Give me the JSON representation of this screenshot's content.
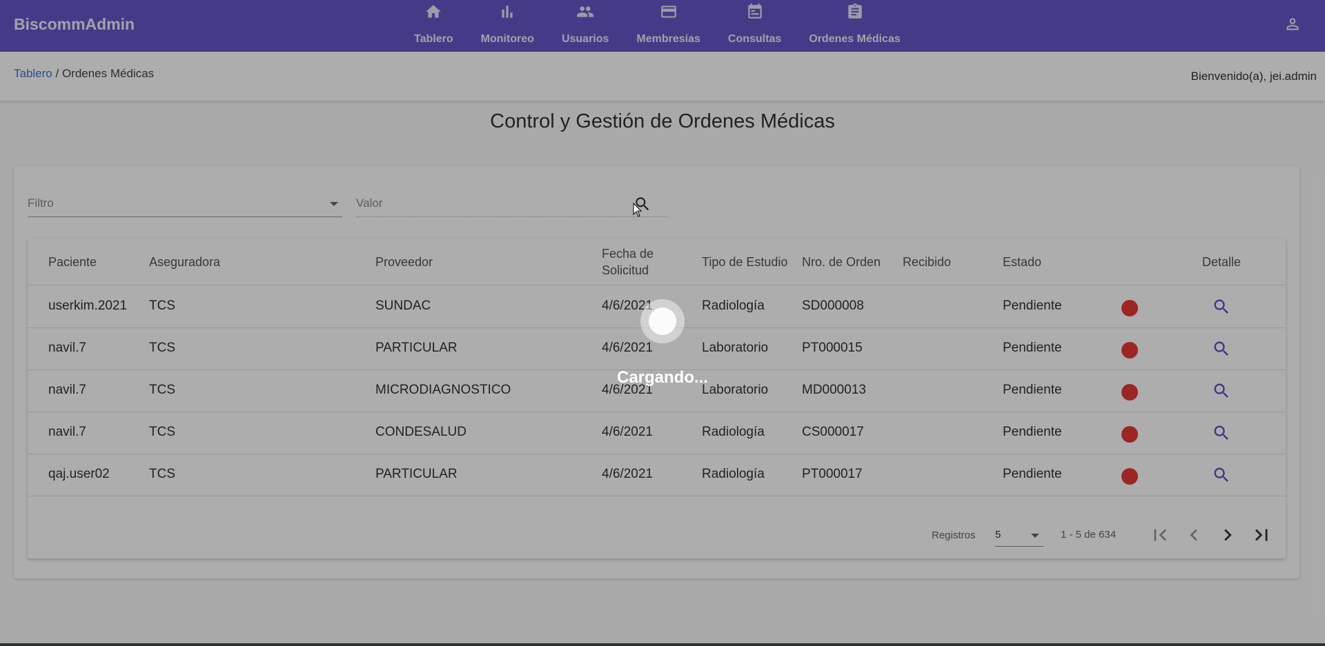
{
  "app": {
    "title": "BiscommAdmin"
  },
  "nav": [
    {
      "label": "Tablero",
      "icon": "home-icon"
    },
    {
      "label": "Monitoreo",
      "icon": "bar-chart-icon"
    },
    {
      "label": "Usuarios",
      "icon": "people-icon"
    },
    {
      "label": "Membresías",
      "icon": "credit-card-icon"
    },
    {
      "label": "Consultas",
      "icon": "calendar-icon"
    },
    {
      "label": "Ordenes Médicas",
      "icon": "clipboard-icon"
    }
  ],
  "breadcrumb": {
    "root": "Tablero",
    "separator": " / ",
    "current": "Ordenes Médicas"
  },
  "welcome": "Bienvenido(a), jei.admin",
  "page_title": "Control y Gestión de Ordenes Médicas",
  "filters": {
    "filter_placeholder": "Filtro",
    "value_placeholder": "Valor"
  },
  "table": {
    "headers": [
      "Paciente",
      "Aseguradora",
      "Proveedor",
      "Fecha de Solicitud",
      "Tipo de Estudio",
      "Nro. de Orden",
      "Recibido",
      "Estado",
      "Detalle"
    ],
    "rows": [
      {
        "paciente": "userkim.2021",
        "aseguradora": "TCS",
        "proveedor": "SUNDAC",
        "fecha": "4/6/2021",
        "tipo": "Radiología",
        "orden": "SD000008",
        "recibido": "",
        "estado": "Pendiente"
      },
      {
        "paciente": "navil.7",
        "aseguradora": "TCS",
        "proveedor": "PARTICULAR",
        "fecha": "4/6/2021",
        "tipo": "Laboratorio",
        "orden": "PT000015",
        "recibido": "",
        "estado": "Pendiente"
      },
      {
        "paciente": "navil.7",
        "aseguradora": "TCS",
        "proveedor": "MICRODIAGNOSTICO",
        "fecha": "4/6/2021",
        "tipo": "Laboratorio",
        "orden": "MD000013",
        "recibido": "",
        "estado": "Pendiente"
      },
      {
        "paciente": "navil.7",
        "aseguradora": "TCS",
        "proveedor": "CONDESALUD",
        "fecha": "4/6/2021",
        "tipo": "Radiología",
        "orden": "CS000017",
        "recibido": "",
        "estado": "Pendiente"
      },
      {
        "paciente": "qaj.user02",
        "aseguradora": "TCS",
        "proveedor": "PARTICULAR",
        "fecha": "4/6/2021",
        "tipo": "Radiología",
        "orden": "PT000017",
        "recibido": "",
        "estado": "Pendiente"
      }
    ]
  },
  "pagination": {
    "registros_label": "Registros",
    "page_size": "5",
    "range": "1 - 5 de 634"
  },
  "loading": {
    "text": "Cargando..."
  },
  "colors": {
    "header": "#6557c9",
    "status_dot": "#e53935",
    "link": "#3f6fd6"
  }
}
